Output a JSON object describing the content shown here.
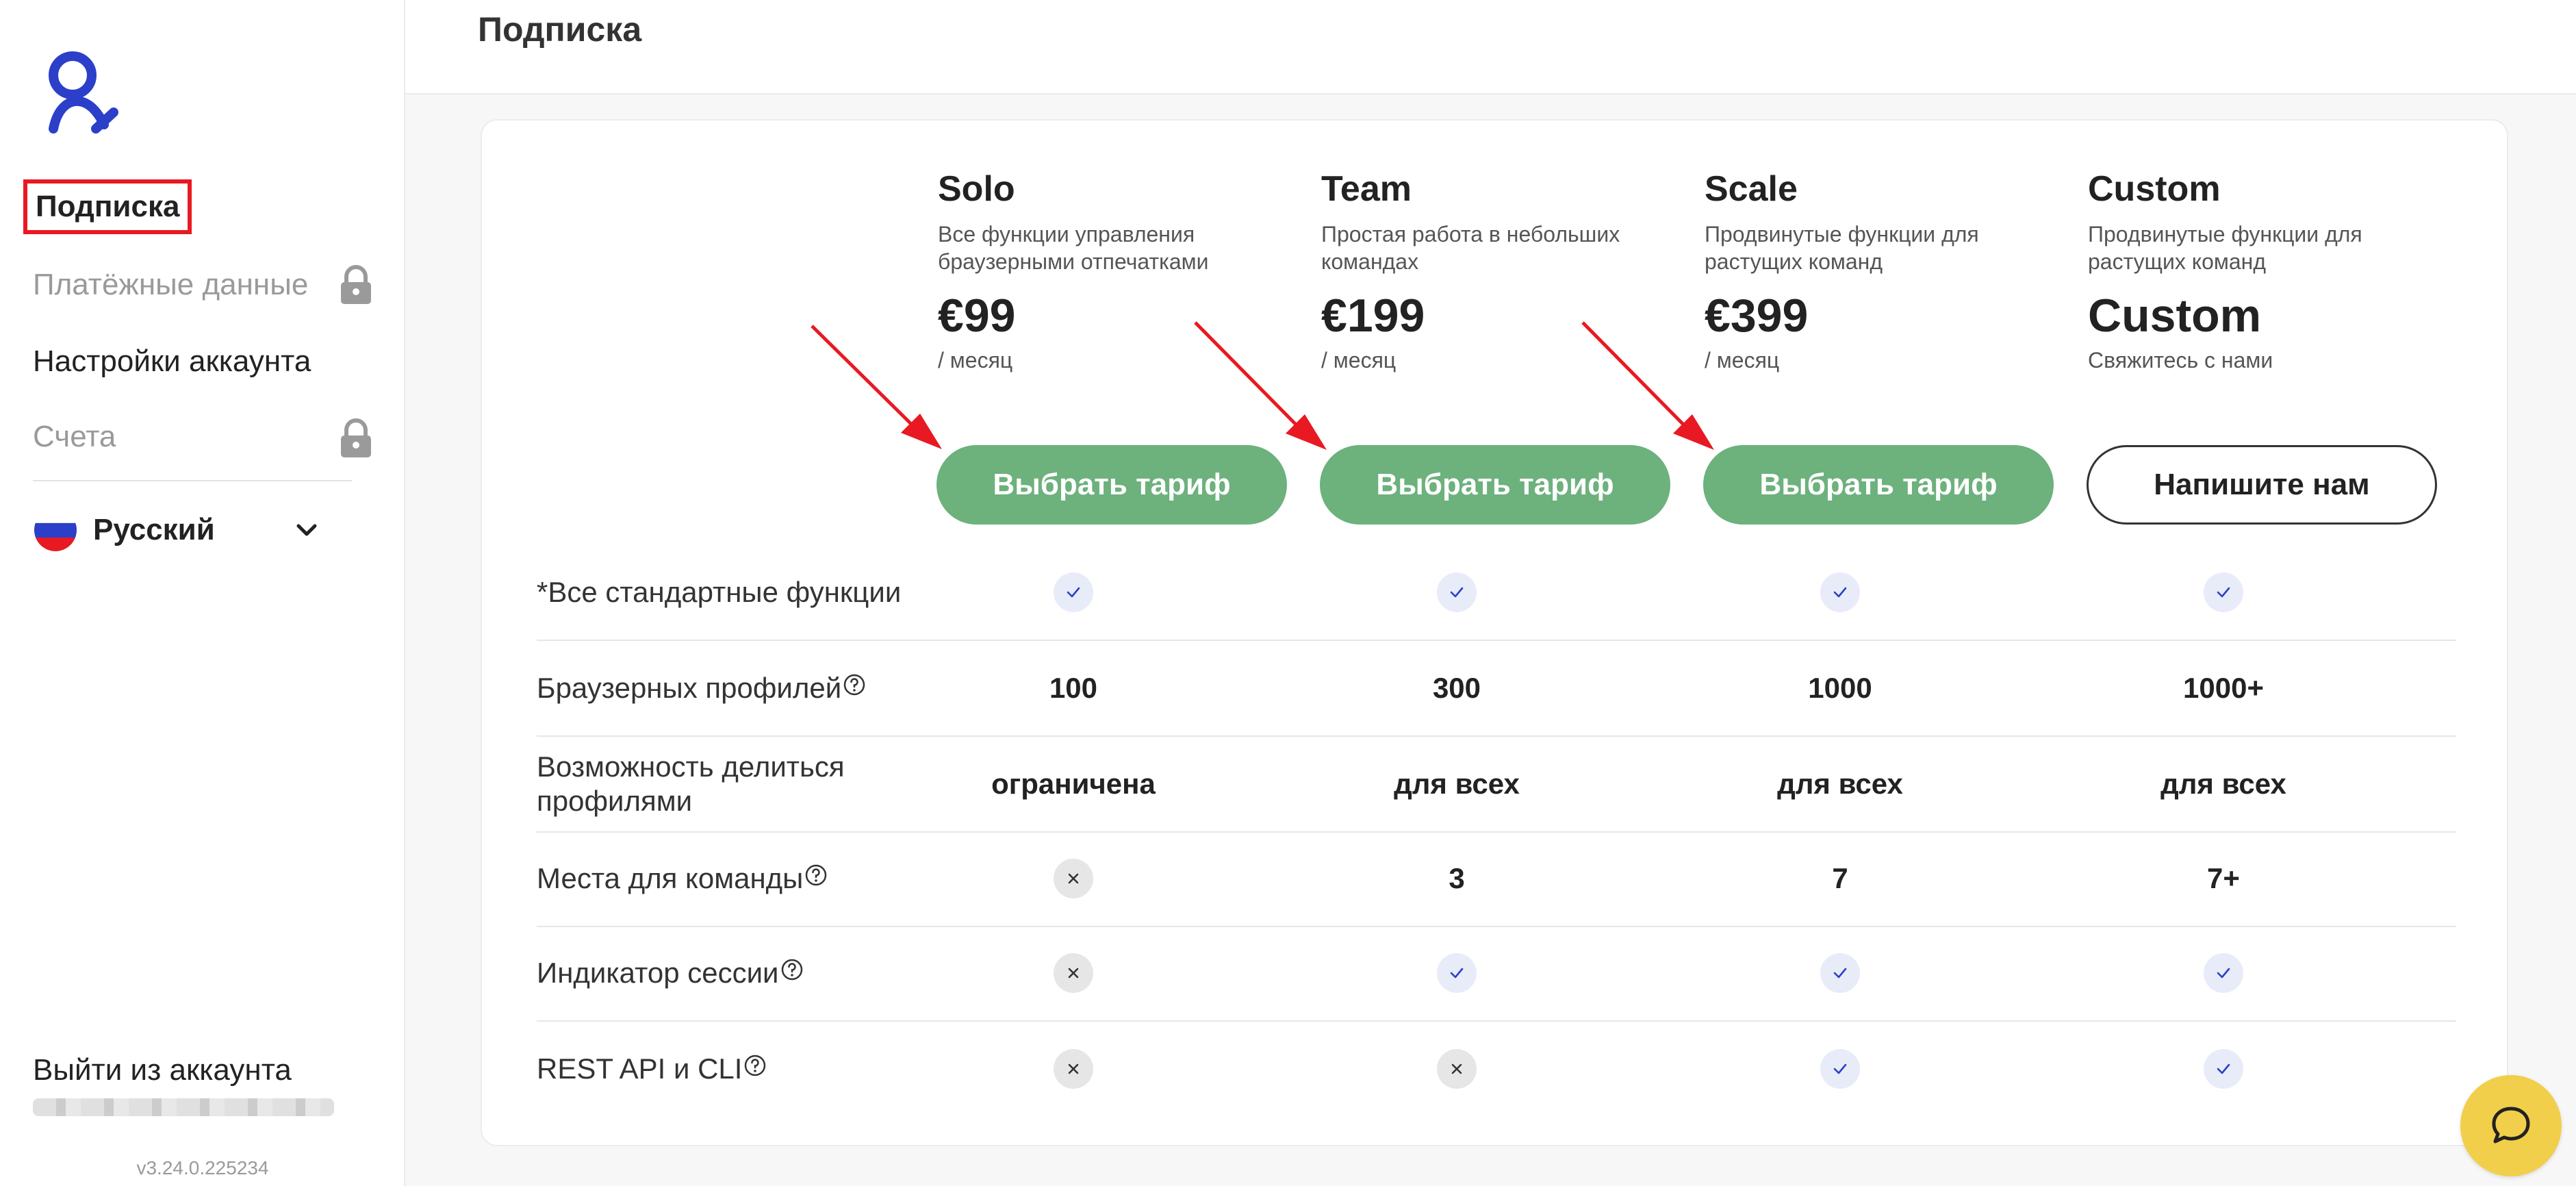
{
  "sidebar": {
    "items": [
      {
        "label": "Подписка",
        "state": "active"
      },
      {
        "label": "Платёжные данные",
        "state": "locked"
      },
      {
        "label": "Настройки аккаунта",
        "state": "normal"
      },
      {
        "label": "Счета",
        "state": "locked"
      }
    ],
    "language": "Русский",
    "logout": "Выйти из аккаунта",
    "version": "v3.24.0.225234"
  },
  "header": {
    "title": "Подписка"
  },
  "plans": [
    {
      "name": "Solo",
      "description": "Все функции управления браузерными отпечатками",
      "price": "€99",
      "period": "/ месяц",
      "button": "Выбрать тариф"
    },
    {
      "name": "Team",
      "description": "Простая работа в небольших командах",
      "price": "€199",
      "period": "/ месяц",
      "button": "Выбрать тариф"
    },
    {
      "name": "Scale",
      "description": "Продвинутые функции для растущих команд",
      "price": "€399",
      "period": "/ месяц",
      "button": "Выбрать тариф"
    },
    {
      "name": "Custom",
      "description": "Продвинутые функции для растущих команд",
      "price": "Custom",
      "period": "Свяжитесь с нами",
      "button": "Напишите нам"
    }
  ],
  "features": [
    {
      "label": "*Все стандартные функции",
      "help": false,
      "values": [
        "check",
        "check",
        "check",
        "check"
      ]
    },
    {
      "label": "Браузерных профилей",
      "help": true,
      "values": [
        "100",
        "300",
        "1000",
        "1000+"
      ]
    },
    {
      "label": "Возможность делиться профилями",
      "help": false,
      "values": [
        "ограничена",
        "для всех",
        "для всех",
        "для всех"
      ]
    },
    {
      "label": "Места для команды",
      "help": true,
      "values": [
        "cross",
        "3",
        "7",
        "7+"
      ]
    },
    {
      "label": "Индикатор сессии",
      "help": true,
      "values": [
        "cross",
        "check",
        "check",
        "check"
      ]
    },
    {
      "label": "REST API и CLI",
      "help": true,
      "values": [
        "cross",
        "cross",
        "check",
        "check"
      ]
    }
  ],
  "colors": {
    "accent_green": "#6db17d",
    "annotation_red": "#e81922",
    "brand_blue": "#2c3fc9",
    "chat_yellow": "#f1cf4a",
    "check_bg": "#e8ecf8"
  },
  "icons": {
    "logo": "octo-logo-icon",
    "lock": "lock-icon",
    "chevron": "chevron-down-icon",
    "help": "question-circle-icon",
    "check": "check-icon",
    "cross": "cross-icon",
    "chat": "chat-bubble-icon"
  }
}
